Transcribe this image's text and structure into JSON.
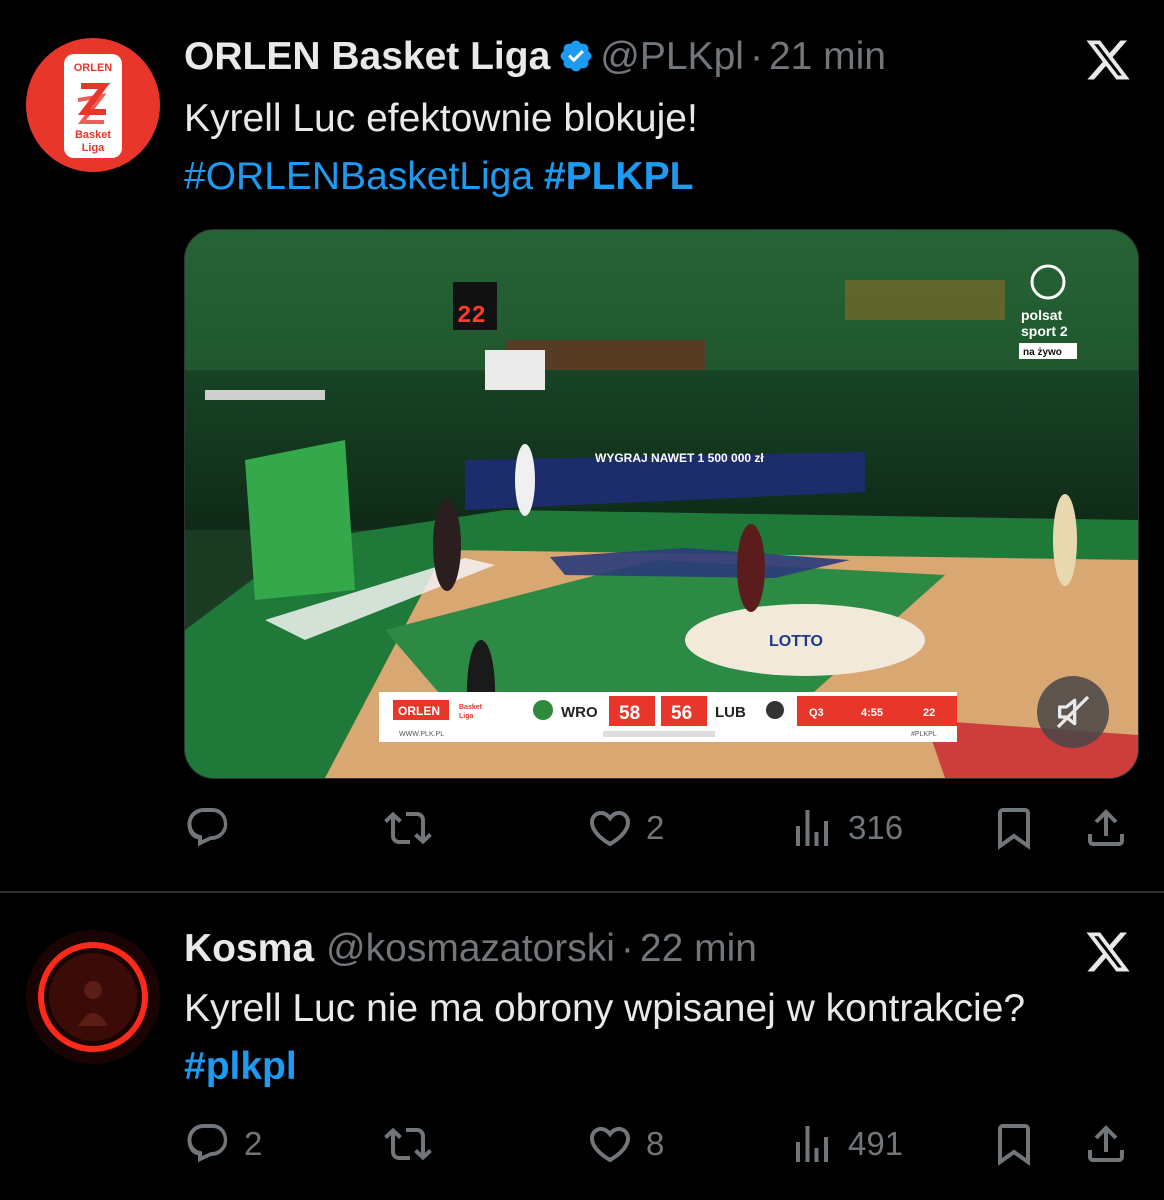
{
  "tweets": [
    {
      "author_name": "ORLEN Basket Liga",
      "handle": "@PLKpl",
      "separator": "·",
      "time": "21 min",
      "avatar_text": {
        "brand": "ORLEN",
        "line1": "Basket",
        "line2": "Liga"
      },
      "text": "Kyrell Luc efektownie blokuje!",
      "hashtags": [
        "#ORLENBasketLiga",
        "#PLKPL"
      ],
      "media": {
        "scoreboard": {
          "sponsor": "ORLEN",
          "league_line1": "Basket",
          "league_line2": "Liga",
          "home_team": "WRO",
          "home_score": "58",
          "away_score": "56",
          "away_team": "LUB",
          "quarter": "Q3",
          "clock": "4:55",
          "shot_clock": "22",
          "site": "WWW.PLK.PL",
          "tag": "#PLKPL"
        },
        "shot_clock_display": "22",
        "banner_text": "WYGRAJ NAWET 1 500 000 zł",
        "lotto_text": "LOTTO",
        "broadcaster": {
          "line1": "polsat",
          "line2": "sport 2",
          "badge": "na żywo"
        },
        "mute_icon": "muted-speaker-icon"
      },
      "actions": {
        "reply": {
          "icon": "reply-icon",
          "count": ""
        },
        "retweet": {
          "icon": "retweet-icon",
          "count": ""
        },
        "like": {
          "icon": "heart-icon",
          "count": "2"
        },
        "views": {
          "icon": "views-icon",
          "count": "316"
        },
        "bookmark": {
          "icon": "bookmark-icon"
        },
        "share": {
          "icon": "share-icon"
        }
      }
    },
    {
      "author_name": "Kosma",
      "handle": "@kosmazatorski",
      "separator": "·",
      "time": "22 min",
      "text": "Kyrell Luc nie ma obrony wpisanej w kontrakcie?",
      "hashtags": [
        "#plkpl"
      ],
      "actions": {
        "reply": {
          "icon": "reply-icon",
          "count": "2"
        },
        "retweet": {
          "icon": "retweet-icon",
          "count": ""
        },
        "like": {
          "icon": "heart-icon",
          "count": "8"
        },
        "views": {
          "icon": "views-icon",
          "count": "491"
        },
        "bookmark": {
          "icon": "bookmark-icon"
        },
        "share": {
          "icon": "share-icon"
        }
      }
    }
  ],
  "colors": {
    "background": "#000000",
    "text": "#e7e9ea",
    "secondary": "#71767b",
    "link": "#1d9bf0",
    "verified": "#1d9bf0",
    "brand_red": "#e8362b"
  }
}
